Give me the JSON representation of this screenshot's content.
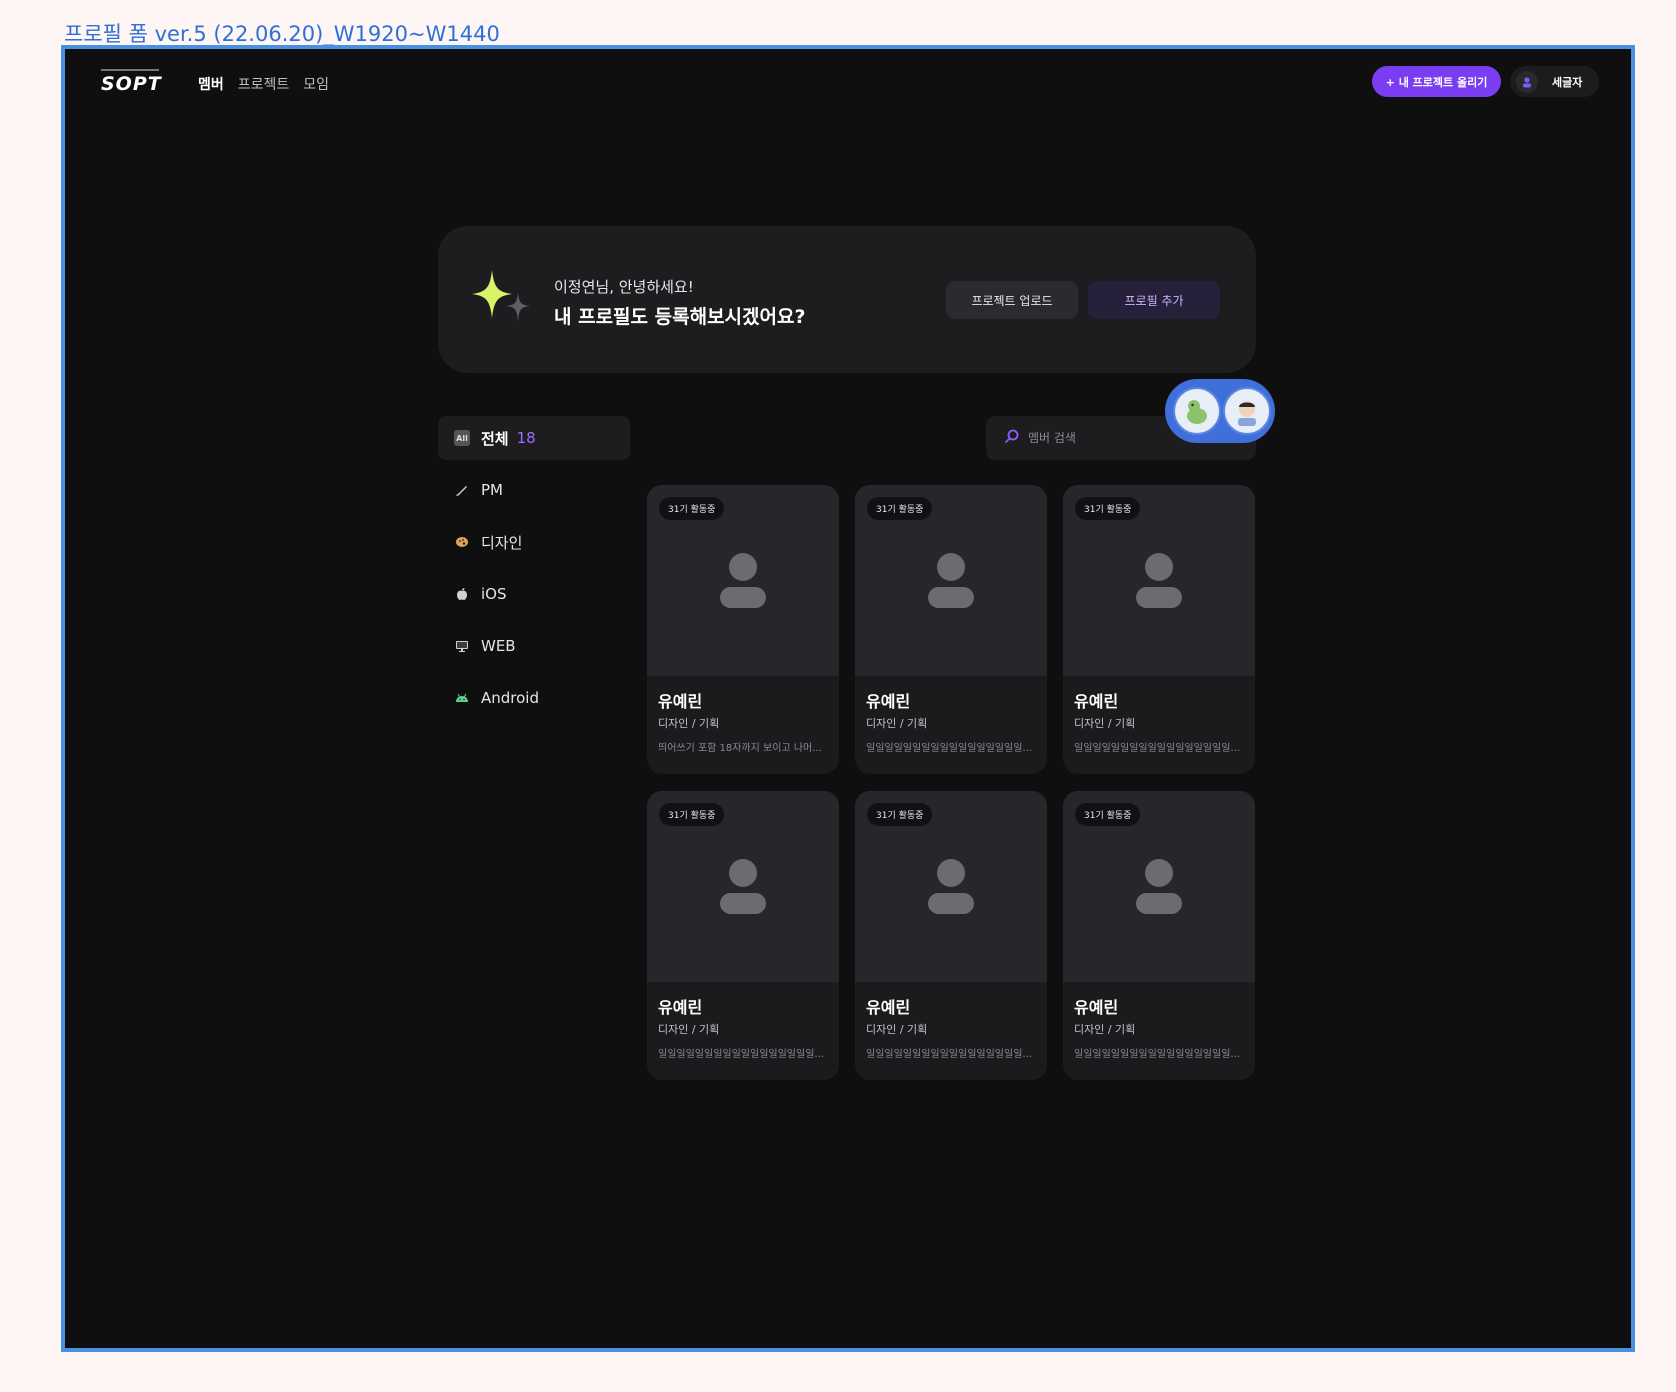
{
  "frame_label": "프로필 폼 ver.5 (22.06.20)_W1920~W1440",
  "header": {
    "logo": "SOPT",
    "nav": [
      "멤버",
      "프로젝트",
      "모임"
    ],
    "upload_label": "+ 내 프로젝트 올리기",
    "user_name": "세글자"
  },
  "banner": {
    "greeting": "이정연님, 안녕하세요!",
    "prompt": "내 프로필도 등록해보시겠어요?",
    "upload_button": "프로젝트 업로드",
    "add_button": "프로필 추가"
  },
  "sidebar": {
    "all_badge": "All",
    "all_label": "전체",
    "all_count": "18",
    "items": [
      "PM",
      "디자인",
      "iOS",
      "WEB",
      "Android"
    ]
  },
  "search": {
    "placeholder": "멤버 검색"
  },
  "colors": {
    "accent": "#7a3df2",
    "background": "#0f0f10",
    "card": "#1b1b1e"
  },
  "cards": [
    {
      "badge": "31기 활동중",
      "name": "유예린",
      "role": "디자인 / 기획",
      "intro": "띄어쓰기 포함 18자까지 보이고 나머..."
    },
    {
      "badge": "31기 활동중",
      "name": "유예린",
      "role": "디자인 / 기획",
      "intro": "일일일일일일일일일일일일일일일일일일..."
    },
    {
      "badge": "31기 활동중",
      "name": "유예린",
      "role": "디자인 / 기획",
      "intro": "일일일일일일일일일일일일일일일일일일..."
    },
    {
      "badge": "31기 활동중",
      "name": "유예린",
      "role": "디자인 / 기획",
      "intro": "일일일일일일일일일일일일일일일일일일..."
    },
    {
      "badge": "31기 활동중",
      "name": "유예린",
      "role": "디자인 / 기획",
      "intro": "일일일일일일일일일일일일일일일일일일..."
    },
    {
      "badge": "31기 활동중",
      "name": "유예린",
      "role": "디자인 / 기획",
      "intro": "일일일일일일일일일일일일일일일일일일..."
    }
  ]
}
